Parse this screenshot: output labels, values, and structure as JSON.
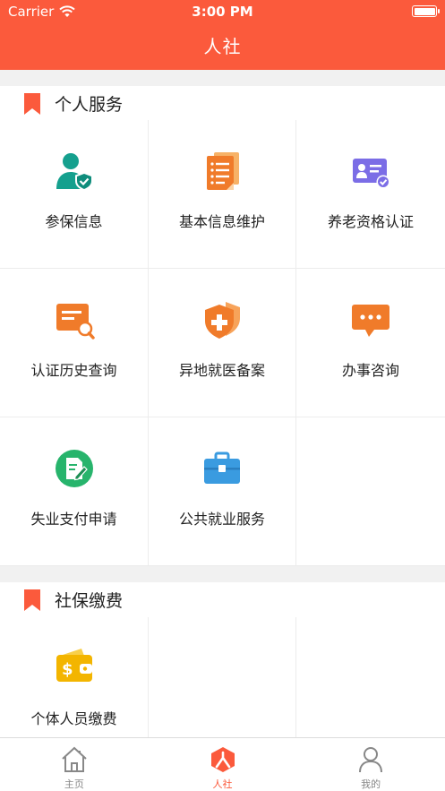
{
  "status_bar": {
    "carrier": "Carrier",
    "time": "3:00 PM"
  },
  "header": {
    "title": "人社"
  },
  "sections": [
    {
      "title": "个人服务",
      "items": [
        {
          "label": "参保信息",
          "icon": "person-shield-icon"
        },
        {
          "label": "基本信息维护",
          "icon": "document-list-icon"
        },
        {
          "label": "养老资格认证",
          "icon": "id-card-check-icon"
        },
        {
          "label": "认证历史查询",
          "icon": "card-search-icon"
        },
        {
          "label": "异地就医备案",
          "icon": "medical-shield-icon"
        },
        {
          "label": "办事咨询",
          "icon": "chat-bubble-icon"
        },
        {
          "label": "失业支付申请",
          "icon": "edit-document-icon"
        },
        {
          "label": "公共就业服务",
          "icon": "briefcase-icon"
        }
      ]
    },
    {
      "title": "社保缴费",
      "items": [
        {
          "label": "个体人员缴费",
          "icon": "wallet-dollar-icon"
        }
      ]
    }
  ],
  "tabbar": [
    {
      "label": "主页",
      "icon": "home-icon",
      "active": false
    },
    {
      "label": "人社",
      "icon": "renshe-logo-icon",
      "active": true
    },
    {
      "label": "我的",
      "icon": "user-icon",
      "active": false
    }
  ],
  "colors": {
    "accent": "#fb5a3c",
    "teal": "#15a08e",
    "orange": "#f07b2a",
    "purple": "#7b6de6",
    "green": "#27b46c",
    "blue": "#3a9be0",
    "gold": "#f3b500"
  }
}
